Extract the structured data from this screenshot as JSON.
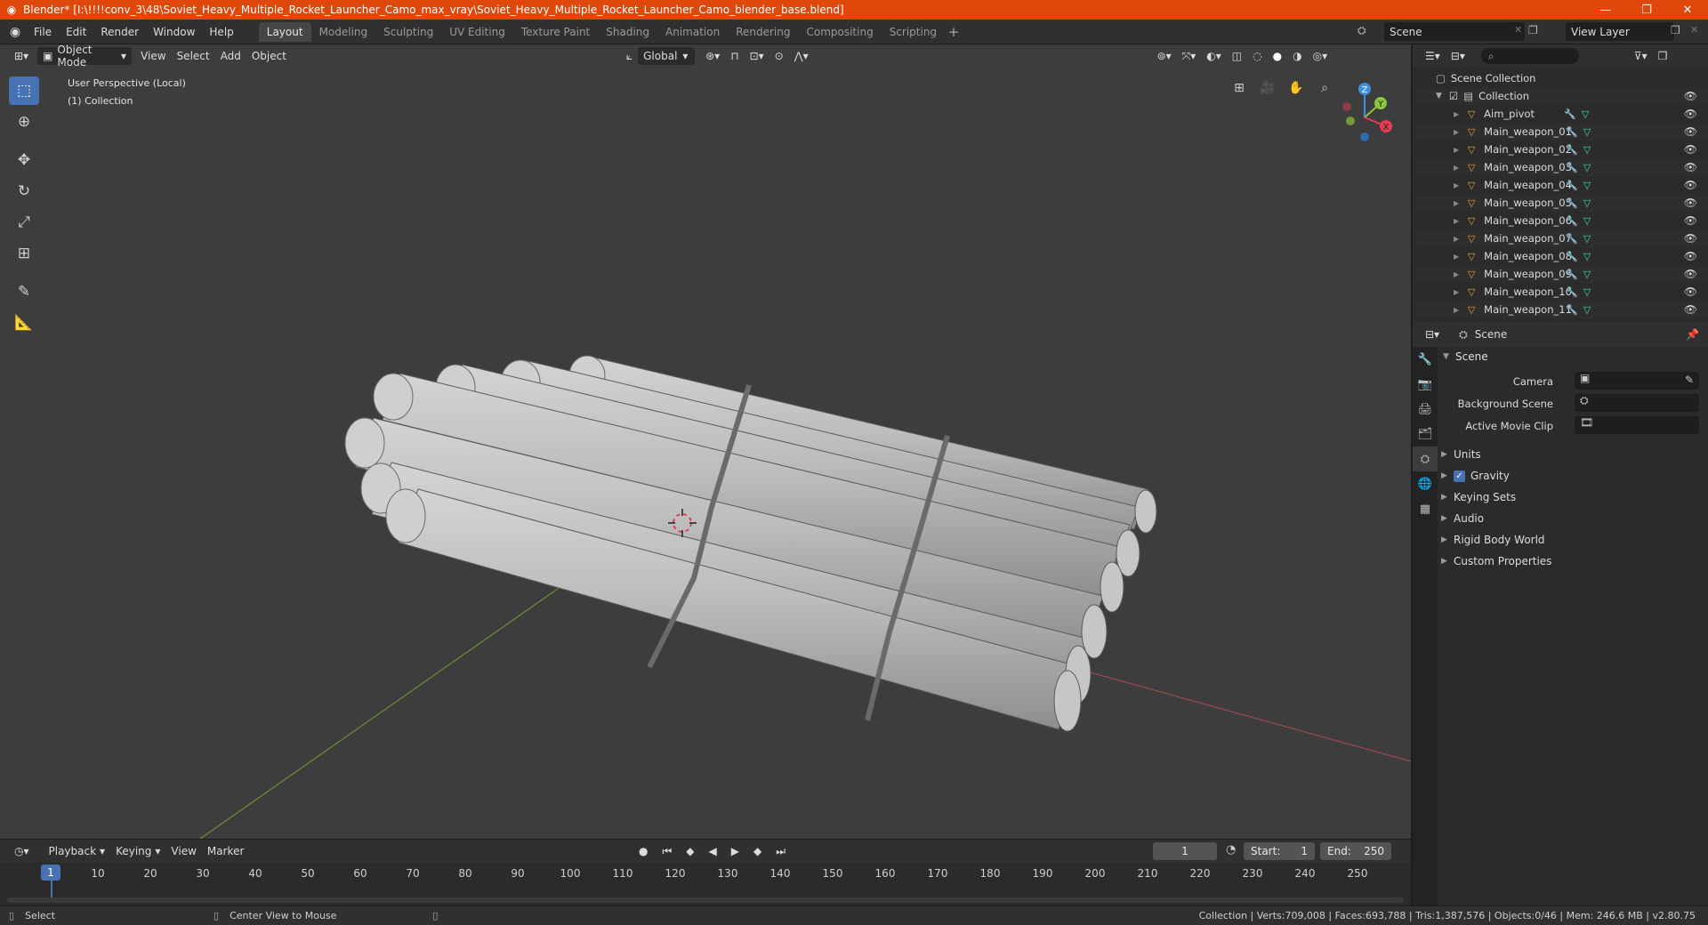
{
  "titlebar": {
    "title": "Blender* [I:\\!!!!conv_3\\48\\Soviet_Heavy_Multiple_Rocket_Launcher_Camo_max_vray\\Soviet_Heavy_Multiple_Rocket_Launcher_Camo_blender_base.blend]",
    "minimize": "—",
    "maximize": "❐",
    "close": "✕"
  },
  "menu": {
    "items": [
      "File",
      "Edit",
      "Render",
      "Window",
      "Help"
    ],
    "workspaces": [
      "Layout",
      "Modeling",
      "Sculpting",
      "UV Editing",
      "Texture Paint",
      "Shading",
      "Animation",
      "Rendering",
      "Compositing",
      "Scripting"
    ],
    "add": "+",
    "scene": "Scene",
    "view_layer": "View Layer"
  },
  "viewport": {
    "mode": "Object Mode",
    "menus": [
      "View",
      "Select",
      "Add",
      "Object"
    ],
    "orientation": "Global",
    "info_line1": "User Perspective (Local)",
    "info_line2": "(1) Collection",
    "gizmo": {
      "z": "Z",
      "y": "Y",
      "x": "X"
    }
  },
  "timeline": {
    "menus": [
      "Playback",
      "Keying",
      "View",
      "Marker"
    ],
    "current_frame": "1",
    "start_label": "Start:",
    "start": "1",
    "end_label": "End:",
    "end": "250",
    "frame_labels": [
      "10",
      "20",
      "30",
      "40",
      "50",
      "60",
      "70",
      "80",
      "90",
      "100",
      "110",
      "120",
      "130",
      "140",
      "150",
      "160",
      "170",
      "180",
      "190",
      "200",
      "210",
      "220",
      "230",
      "240",
      "250"
    ],
    "cur_label": "1"
  },
  "statusbar": {
    "select": "Select",
    "center": "Center View to Mouse",
    "stats": "Collection | Verts:709,008 | Faces:693,788 | Tris:1,387,576 | Objects:0/46 | Mem: 246.6 MB | v2.80.75"
  },
  "outliner": {
    "scene_collection": "Scene Collection",
    "collection": "Collection",
    "items": [
      "Aim_pivot",
      "Main_weapon_01",
      "Main_weapon_02",
      "Main_weapon_03",
      "Main_weapon_04",
      "Main_weapon_05",
      "Main_weapon_06",
      "Main_weapon_07",
      "Main_weapon_08",
      "Main_weapon_09",
      "Main_weapon_10",
      "Main_weapon_11"
    ]
  },
  "properties": {
    "context": "Scene",
    "panel": "Scene",
    "camera_label": "Camera",
    "bg_scene_label": "Background Scene",
    "movie_clip_label": "Active Movie Clip",
    "subpanels": [
      "Units",
      "Gravity",
      "Keying Sets",
      "Audio",
      "Rigid Body World",
      "Custom Properties"
    ]
  },
  "colors": {
    "titlebar": "#e0470b",
    "accent": "#4772b3",
    "viewport_bg": "#3d3d3d",
    "x_axis": "#e23d53",
    "y_axis": "#8cc63f",
    "z_axis": "#3d8fe2"
  }
}
